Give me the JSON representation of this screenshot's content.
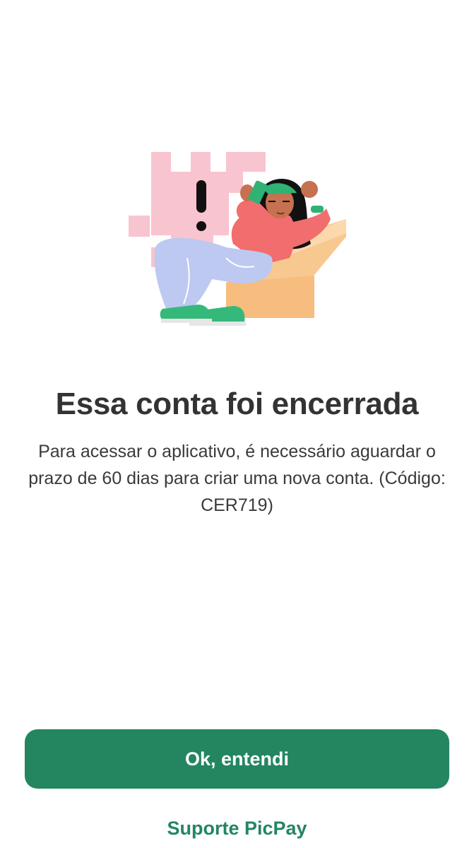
{
  "illustration": {
    "icon": "closed-account-illustration",
    "description_colors": {
      "pink_blocks": "#f8c4d0",
      "shirt": "#f26d6d",
      "pants": "#bdc9f0",
      "chair": "#f8c891",
      "shoes": "#35b97a",
      "card": "#2fb274"
    }
  },
  "content": {
    "title": "Essa conta foi encerrada",
    "message": "Para acessar o aplicativo, é necessário aguardar o prazo de 60 dias para criar uma nova conta. (Código: CER719)"
  },
  "actions": {
    "primary_label": "Ok, entendi",
    "secondary_label": "Suporte PicPay"
  },
  "colors": {
    "brand_green": "#238661",
    "title_text": "#333333",
    "body_text": "#3a3a3a",
    "background": "#ffffff"
  }
}
